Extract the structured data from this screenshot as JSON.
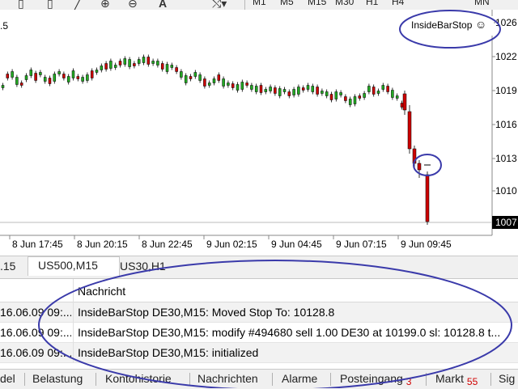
{
  "toolbar": {
    "timeframes": [
      "M1",
      "M5",
      "M15",
      "M30",
      "H1",
      "H4",
      "MN"
    ],
    "icons": [
      "chart-bar-icon",
      "chart-candle-icon",
      "chart-line-icon",
      "zoom-in-icon",
      "zoom-out-icon",
      "objects-icon",
      "text-icon",
      "template-icon"
    ]
  },
  "chart": {
    "corner_label": ".5",
    "ea_name": "InsideBarStop",
    "ea_icon": "smiley-icon",
    "current_price": "1007",
    "price_labels": [
      "1026",
      "1022",
      "1019",
      "1016",
      "1013",
      "1010",
      "1007"
    ],
    "time_labels": [
      "8 Jun 17:45",
      "8 Jun 20:15",
      "8 Jun 22:45",
      "9 Jun 02:15",
      "9 Jun 04:45",
      "9 Jun 07:15",
      "9 Jun 09:45"
    ],
    "bull_color": "#22aa22",
    "bear_color": "#cc0000"
  },
  "chart_tabs": [
    ".15",
    "US500,M15",
    "US30,H1"
  ],
  "journal": {
    "column_header": "Nachricht",
    "rows": [
      {
        "time": "16.06.09 09:...",
        "message": "InsideBarStop DE30,M15: Moved Stop To: 10128.8"
      },
      {
        "time": "16.06.09 09:...",
        "message": "InsideBarStop DE30,M15: modify #494680 sell 1.00 DE30 at 10199.0 sl: 10128.8 t..."
      },
      {
        "time": "16.06.09 09:...",
        "message": "InsideBarStop DE30,M15: initialized"
      }
    ]
  },
  "bottom_tabs": [
    {
      "label": "del",
      "badge": ""
    },
    {
      "label": "Belastung",
      "badge": ""
    },
    {
      "label": "Kontohistorie",
      "badge": ""
    },
    {
      "label": "Nachrichten",
      "badge": ""
    },
    {
      "label": "Alarme",
      "badge": ""
    },
    {
      "label": "Posteingang",
      "badge": "3"
    },
    {
      "label": "Markt",
      "badge": "55"
    },
    {
      "label": "Sig",
      "badge": ""
    }
  ],
  "annotation_color": "#3a3aaa"
}
